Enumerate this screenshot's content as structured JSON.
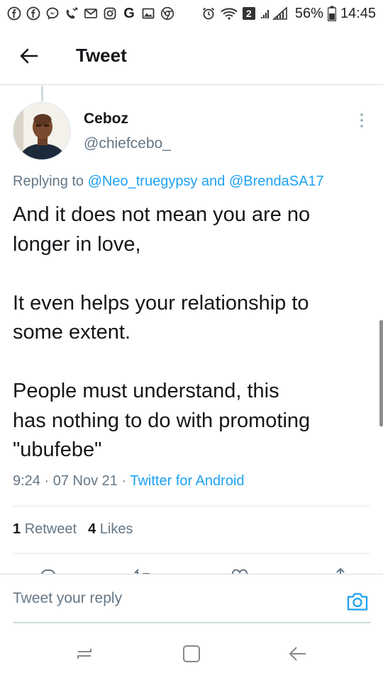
{
  "status_bar": {
    "battery_text": "56%",
    "time": "14:45",
    "sim_badge": "2",
    "notification_icons": [
      "facebook-icon",
      "facebook-icon",
      "messenger-icon",
      "missed-call-icon",
      "gmail-icon",
      "instagram-icon",
      "google-icon",
      "gallery-icon",
      "chrome-icon"
    ]
  },
  "header": {
    "title": "Tweet"
  },
  "tweet": {
    "display_name": "Ceboz",
    "handle": "@chiefcebo_",
    "replying_prefix": "Replying to",
    "mention_1": "@Neo_truegypsy",
    "replying_and": "and",
    "mention_2": "@BrendaSA17",
    "body_lines": [
      "And it does not mean you are no",
      "longer in love,",
      "",
      "It even helps your relationship to",
      "some extent.",
      "",
      "People must understand, this",
      "has nothing to do with promoting",
      "\"ubufebe\""
    ],
    "time": "9:24",
    "date": "07 Nov 21",
    "separator": "·",
    "source": "Twitter for Android",
    "retweet_count": "1",
    "retweet_label": "Retweet",
    "likes_count": "4",
    "likes_label": "Likes"
  },
  "reply_bar": {
    "placeholder": "Tweet your reply"
  },
  "colors": {
    "accent": "#1da1f2",
    "secondary_text": "#657786",
    "primary_text": "#14171a",
    "divider": "#e1e8ed"
  }
}
